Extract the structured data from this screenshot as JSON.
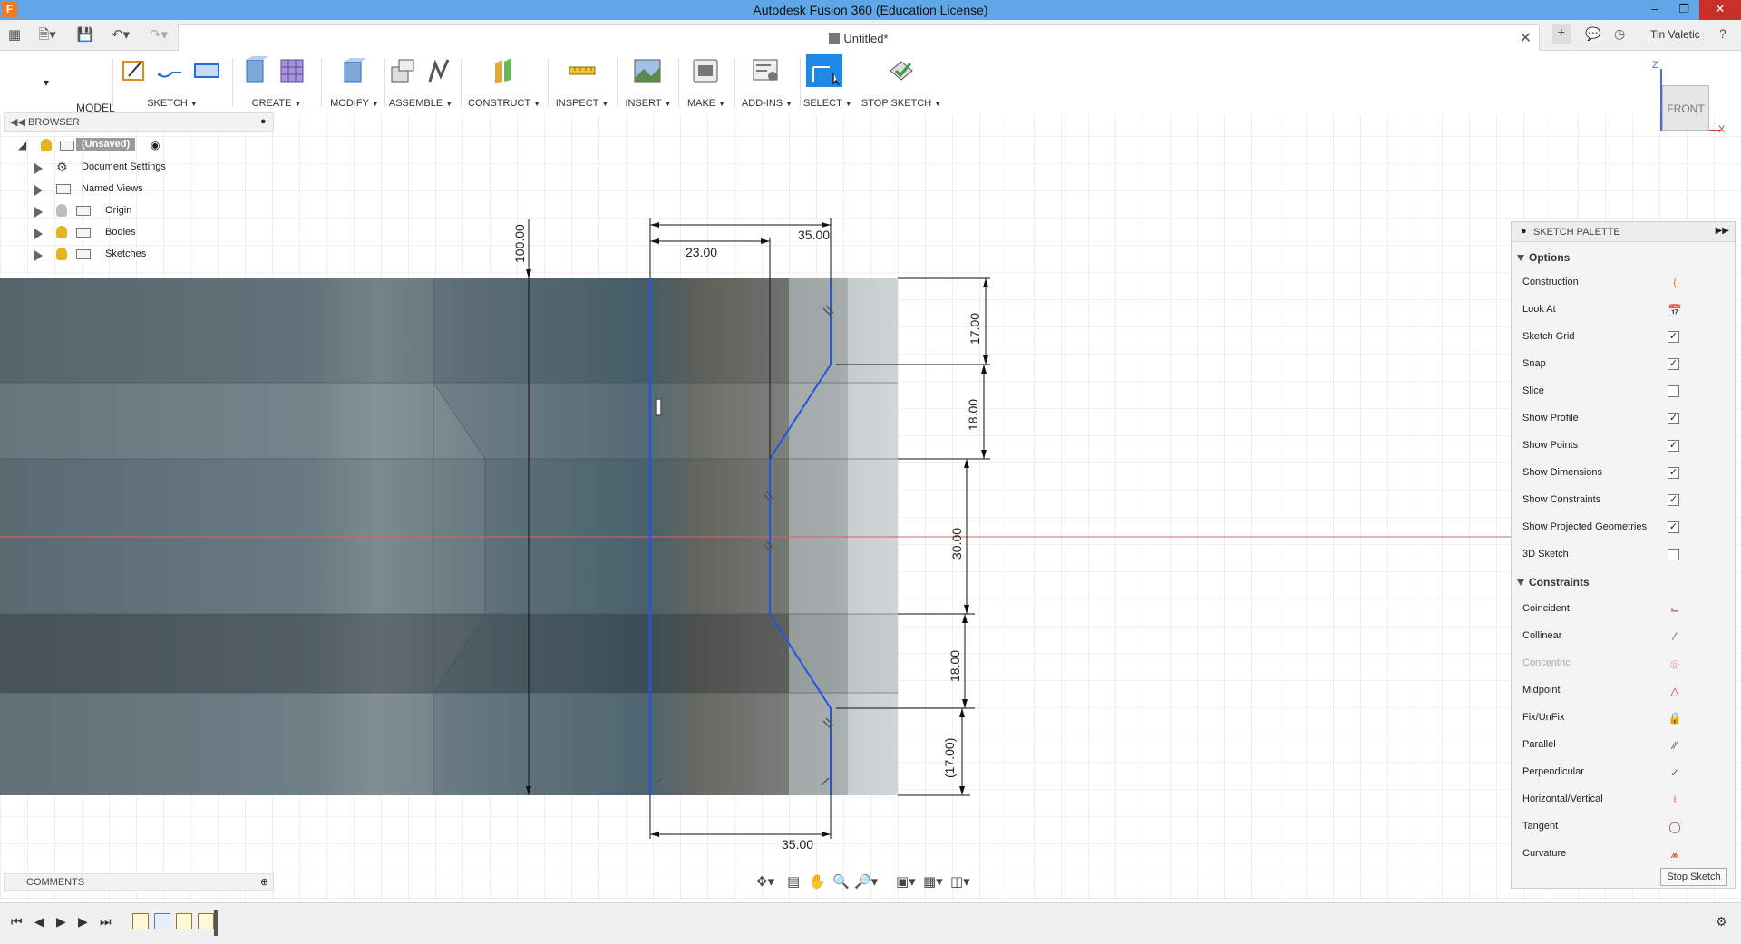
{
  "app": {
    "title": "Autodesk Fusion 360 (Education License)",
    "icon_letter": "F"
  },
  "tab": {
    "title": "Untitled*"
  },
  "user": {
    "name": "Tin Valetic"
  },
  "toolbar": {
    "workspace": "MODEL",
    "groups": [
      "SKETCH",
      "CREATE",
      "MODIFY",
      "ASSEMBLE",
      "CONSTRUCT",
      "INSPECT",
      "INSERT",
      "MAKE",
      "ADD-INS",
      "SELECT",
      "STOP SKETCH"
    ]
  },
  "viewcube": {
    "face": "FRONT",
    "z": "Z",
    "x": "X"
  },
  "browser": {
    "header": "BROWSER",
    "root": "(Unsaved)",
    "items": [
      "Document Settings",
      "Named Views",
      "Origin",
      "Bodies",
      "Sketches"
    ]
  },
  "dimensions": {
    "d100": "100.00",
    "d35_top": "35.00",
    "d23": "23.00",
    "d17_top": "17.00",
    "d18_upper": "18.00",
    "d30": "30.00",
    "d18_lower": "18.00",
    "d17_bottom": "(17.00)",
    "d35_bottom": "35.00"
  },
  "palette": {
    "header": "SKETCH PALETTE",
    "options_title": "Options",
    "options": [
      {
        "label": "Construction",
        "icon": "construction-icon"
      },
      {
        "label": "Look At",
        "icon": "look-at-icon"
      },
      {
        "label": "Sketch Grid",
        "checked": true
      },
      {
        "label": "Snap",
        "checked": true
      },
      {
        "label": "Slice",
        "checked": false
      },
      {
        "label": "Show Profile",
        "checked": true
      },
      {
        "label": "Show Points",
        "checked": true
      },
      {
        "label": "Show Dimensions",
        "checked": true
      },
      {
        "label": "Show Constraints",
        "checked": true
      },
      {
        "label": "Show Projected Geometries",
        "checked": true
      },
      {
        "label": "3D Sketch",
        "checked": false
      }
    ],
    "constraints_title": "Constraints",
    "constraints": [
      {
        "label": "Coincident",
        "icon": "coincident-icon"
      },
      {
        "label": "Collinear",
        "icon": "collinear-icon"
      },
      {
        "label": "Concentric",
        "icon": "concentric-icon",
        "disabled": true
      },
      {
        "label": "Midpoint",
        "icon": "midpoint-icon"
      },
      {
        "label": "Fix/UnFix",
        "icon": "fix-icon"
      },
      {
        "label": "Parallel",
        "icon": "parallel-icon"
      },
      {
        "label": "Perpendicular",
        "icon": "perpendicular-icon"
      },
      {
        "label": "Horizontal/Vertical",
        "icon": "horizontal-vertical-icon"
      },
      {
        "label": "Tangent",
        "icon": "tangent-icon"
      },
      {
        "label": "Curvature",
        "icon": "curvature-icon"
      }
    ],
    "stop_label": "Stop Sketch"
  },
  "comments": {
    "header": "COMMENTS"
  },
  "colors": {
    "accent": "#1e88e5",
    "title_bar": "#5fa7e6",
    "sketch_line": "#2256e0",
    "axis_red": "#e06060"
  }
}
